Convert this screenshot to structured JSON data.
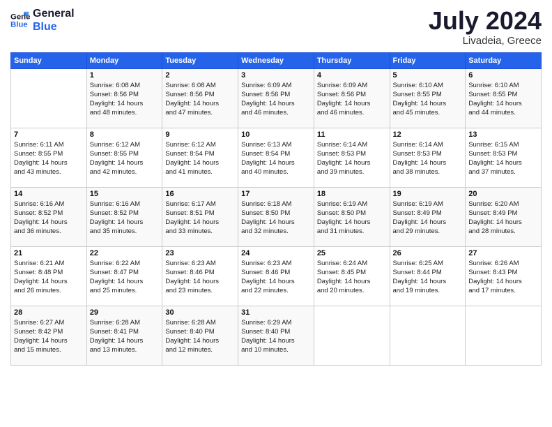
{
  "logo": {
    "line1": "General",
    "line2": "Blue"
  },
  "title": "July 2024",
  "subtitle": "Livadeia, Greece",
  "header_days": [
    "Sunday",
    "Monday",
    "Tuesday",
    "Wednesday",
    "Thursday",
    "Friday",
    "Saturday"
  ],
  "weeks": [
    [
      {
        "day": "",
        "info": ""
      },
      {
        "day": "1",
        "info": "Sunrise: 6:08 AM\nSunset: 8:56 PM\nDaylight: 14 hours\nand 48 minutes."
      },
      {
        "day": "2",
        "info": "Sunrise: 6:08 AM\nSunset: 8:56 PM\nDaylight: 14 hours\nand 47 minutes."
      },
      {
        "day": "3",
        "info": "Sunrise: 6:09 AM\nSunset: 8:56 PM\nDaylight: 14 hours\nand 46 minutes."
      },
      {
        "day": "4",
        "info": "Sunrise: 6:09 AM\nSunset: 8:56 PM\nDaylight: 14 hours\nand 46 minutes."
      },
      {
        "day": "5",
        "info": "Sunrise: 6:10 AM\nSunset: 8:55 PM\nDaylight: 14 hours\nand 45 minutes."
      },
      {
        "day": "6",
        "info": "Sunrise: 6:10 AM\nSunset: 8:55 PM\nDaylight: 14 hours\nand 44 minutes."
      }
    ],
    [
      {
        "day": "7",
        "info": "Sunrise: 6:11 AM\nSunset: 8:55 PM\nDaylight: 14 hours\nand 43 minutes."
      },
      {
        "day": "8",
        "info": "Sunrise: 6:12 AM\nSunset: 8:55 PM\nDaylight: 14 hours\nand 42 minutes."
      },
      {
        "day": "9",
        "info": "Sunrise: 6:12 AM\nSunset: 8:54 PM\nDaylight: 14 hours\nand 41 minutes."
      },
      {
        "day": "10",
        "info": "Sunrise: 6:13 AM\nSunset: 8:54 PM\nDaylight: 14 hours\nand 40 minutes."
      },
      {
        "day": "11",
        "info": "Sunrise: 6:14 AM\nSunset: 8:53 PM\nDaylight: 14 hours\nand 39 minutes."
      },
      {
        "day": "12",
        "info": "Sunrise: 6:14 AM\nSunset: 8:53 PM\nDaylight: 14 hours\nand 38 minutes."
      },
      {
        "day": "13",
        "info": "Sunrise: 6:15 AM\nSunset: 8:53 PM\nDaylight: 14 hours\nand 37 minutes."
      }
    ],
    [
      {
        "day": "14",
        "info": "Sunrise: 6:16 AM\nSunset: 8:52 PM\nDaylight: 14 hours\nand 36 minutes."
      },
      {
        "day": "15",
        "info": "Sunrise: 6:16 AM\nSunset: 8:52 PM\nDaylight: 14 hours\nand 35 minutes."
      },
      {
        "day": "16",
        "info": "Sunrise: 6:17 AM\nSunset: 8:51 PM\nDaylight: 14 hours\nand 33 minutes."
      },
      {
        "day": "17",
        "info": "Sunrise: 6:18 AM\nSunset: 8:50 PM\nDaylight: 14 hours\nand 32 minutes."
      },
      {
        "day": "18",
        "info": "Sunrise: 6:19 AM\nSunset: 8:50 PM\nDaylight: 14 hours\nand 31 minutes."
      },
      {
        "day": "19",
        "info": "Sunrise: 6:19 AM\nSunset: 8:49 PM\nDaylight: 14 hours\nand 29 minutes."
      },
      {
        "day": "20",
        "info": "Sunrise: 6:20 AM\nSunset: 8:49 PM\nDaylight: 14 hours\nand 28 minutes."
      }
    ],
    [
      {
        "day": "21",
        "info": "Sunrise: 6:21 AM\nSunset: 8:48 PM\nDaylight: 14 hours\nand 26 minutes."
      },
      {
        "day": "22",
        "info": "Sunrise: 6:22 AM\nSunset: 8:47 PM\nDaylight: 14 hours\nand 25 minutes."
      },
      {
        "day": "23",
        "info": "Sunrise: 6:23 AM\nSunset: 8:46 PM\nDaylight: 14 hours\nand 23 minutes."
      },
      {
        "day": "24",
        "info": "Sunrise: 6:23 AM\nSunset: 8:46 PM\nDaylight: 14 hours\nand 22 minutes."
      },
      {
        "day": "25",
        "info": "Sunrise: 6:24 AM\nSunset: 8:45 PM\nDaylight: 14 hours\nand 20 minutes."
      },
      {
        "day": "26",
        "info": "Sunrise: 6:25 AM\nSunset: 8:44 PM\nDaylight: 14 hours\nand 19 minutes."
      },
      {
        "day": "27",
        "info": "Sunrise: 6:26 AM\nSunset: 8:43 PM\nDaylight: 14 hours\nand 17 minutes."
      }
    ],
    [
      {
        "day": "28",
        "info": "Sunrise: 6:27 AM\nSunset: 8:42 PM\nDaylight: 14 hours\nand 15 minutes."
      },
      {
        "day": "29",
        "info": "Sunrise: 6:28 AM\nSunset: 8:41 PM\nDaylight: 14 hours\nand 13 minutes."
      },
      {
        "day": "30",
        "info": "Sunrise: 6:28 AM\nSunset: 8:40 PM\nDaylight: 14 hours\nand 12 minutes."
      },
      {
        "day": "31",
        "info": "Sunrise: 6:29 AM\nSunset: 8:40 PM\nDaylight: 14 hours\nand 10 minutes."
      },
      {
        "day": "",
        "info": ""
      },
      {
        "day": "",
        "info": ""
      },
      {
        "day": "",
        "info": ""
      }
    ]
  ]
}
